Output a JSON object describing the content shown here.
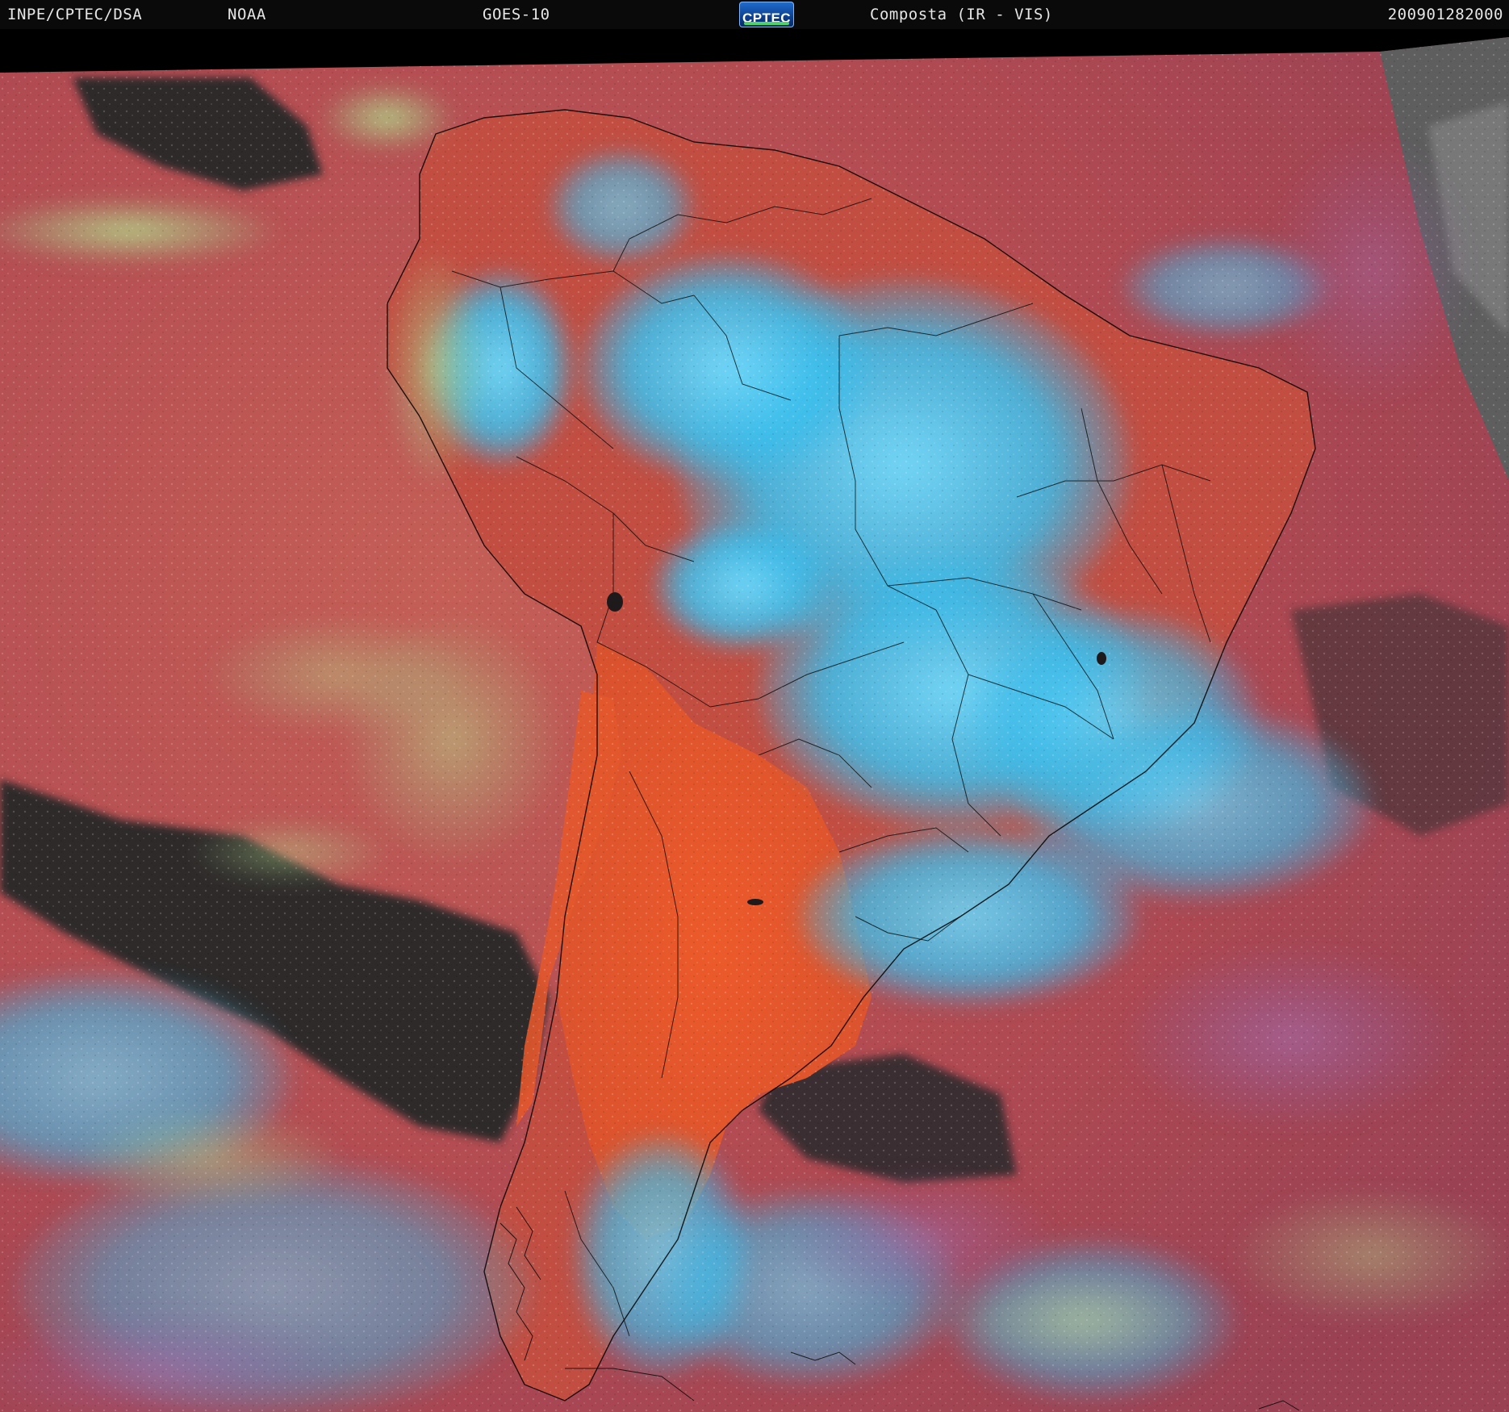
{
  "header": {
    "agency": "INPE/CPTEC/DSA",
    "source": "NOAA",
    "satellite": "GOES-10",
    "logo_text": "CPTEC",
    "product": "Composta (IR - VIS)",
    "timestamp": "200901282000"
  },
  "colors": {
    "background": "#000000",
    "clear_ocean": "#b04a52",
    "clear_land": "#d25a3c",
    "high_cloud": "#3cc8f0",
    "low_cloud_mixed": "#9ccc8c",
    "dark_ocean": "#2e2a2c",
    "visible_gray": "#6e6e6e",
    "border_line": "#000000"
  },
  "image": {
    "subject": "South America composite satellite image",
    "map_features": [
      "country-borders",
      "state-borders",
      "coastline"
    ]
  }
}
